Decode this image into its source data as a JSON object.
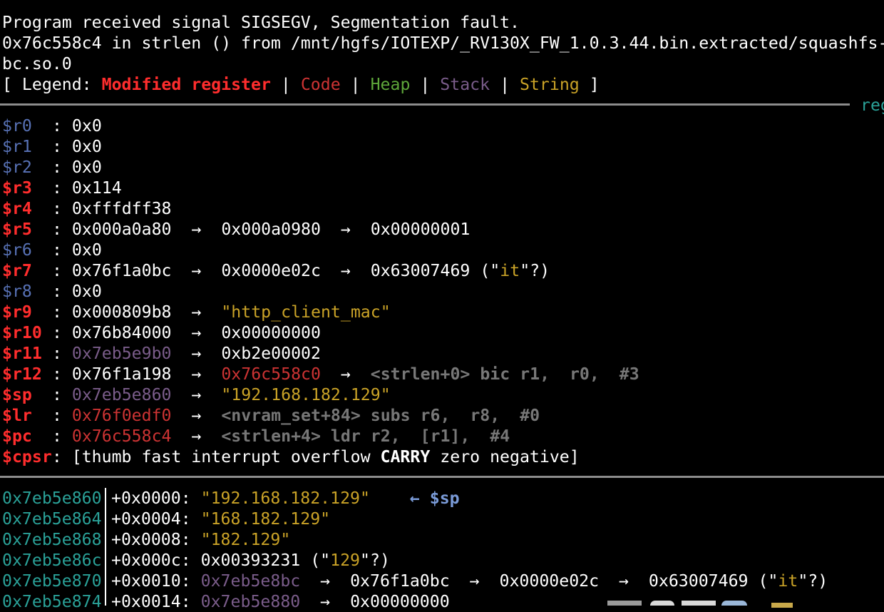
{
  "header": {
    "line1": "Program received signal SIGSEGV, Segmentation fault.",
    "line2": "0x76c558c4 in strlen () from /mnt/hgfs/IOTEXP/_RV130X_FW_1.0.3.44.bin.extracted/squashfs-",
    "line3": "bc.so.0"
  },
  "legend": {
    "open": "[ Legend: ",
    "modified": "Modified register",
    "sep": " | ",
    "code": "Code",
    "heap": "Heap",
    "stack": "Stack",
    "string": "String",
    "close": " ]"
  },
  "registers_label": "reg",
  "registers": {
    "r0": {
      "name": "$r0",
      "value": "0x0"
    },
    "r1": {
      "name": "$r1",
      "value": "0x0"
    },
    "r2": {
      "name": "$r2",
      "value": "0x0"
    },
    "r3": {
      "name": "$r3",
      "value": "0x114"
    },
    "r4": {
      "name": "$r4",
      "value": "0xfffdff38"
    },
    "r5": {
      "name": "$r5",
      "value": "0x000a0a80",
      "p1": "0x000a0980",
      "p2": "0x00000001"
    },
    "r6": {
      "name": "$r6",
      "value": "0x0"
    },
    "r7": {
      "name": "$r7",
      "value": "0x76f1a0bc",
      "p1": "0x0000e02c",
      "p2": "0x63007469",
      "hint_open": " (\"",
      "hint": "it",
      "hint_close": "\"?)"
    },
    "r8": {
      "name": "$r8",
      "value": "0x0"
    },
    "r9": {
      "name": "$r9",
      "value": "0x000809b8",
      "str": "\"http_client_mac\""
    },
    "r10": {
      "name": "$r10",
      "value": "0x76b84000",
      "p1": "0x00000000"
    },
    "r11": {
      "name": "$r11",
      "value": "0x7eb5e9b0",
      "p1": "0xb2e00002"
    },
    "r12": {
      "name": "$r12",
      "value": "0x76f1a198",
      "p1": "0x76c558c0",
      "insn": "<strlen+0> bic r1,  r0,  #3"
    },
    "sp": {
      "name": "$sp",
      "value": "0x7eb5e860",
      "str": "\"192.168.182.129\""
    },
    "lr": {
      "name": "$lr",
      "value": "0x76f0edf0",
      "insn": "<nvram_set+84> subs r6,  r8,  #0"
    },
    "pc": {
      "name": "$pc",
      "value": "0x76c558c4",
      "insn": "<strlen+4> ldr r2,  [r1],  #4"
    },
    "cpsr": {
      "name": "$cpsr",
      "flags_a": "[thumb fast interrupt overflow ",
      "carry": "CARRY",
      "flags_b": " zero negative]"
    }
  },
  "arrow": "→",
  "colon": ": ",
  "stack": [
    {
      "addr": "0x7eb5e860",
      "off": "+0x0000: ",
      "str": "\"192.168.182.129\"",
      "mark_arrow": "←",
      "mark": "$sp"
    },
    {
      "addr": "0x7eb5e864",
      "off": "+0x0004: ",
      "str": "\"168.182.129\""
    },
    {
      "addr": "0x7eb5e868",
      "off": "+0x0008: ",
      "str": "\"182.129\""
    },
    {
      "addr": "0x7eb5e86c",
      "off": "+0x000c: ",
      "val": "0x00393231",
      "hint_open": " (\"",
      "hint": "129",
      "hint_close": "\"?)"
    },
    {
      "addr": "0x7eb5e870",
      "off": "+0x0010: ",
      "val": "0x7eb5e8bc",
      "p1": "0x76f1a0bc",
      "p2": "0x0000e02c",
      "p3": "0x63007469",
      "hint_open": " (\"",
      "hint": "it",
      "hint_close": "\"?)"
    },
    {
      "addr": "0x7eb5e874",
      "off": "+0x0014: ",
      "val": "0x7eb5e880",
      "p1": "0x00000000"
    }
  ],
  "colors": {
    "modified": "#ff2d2d",
    "code": "#cc3333",
    "heap": "#5ea73a",
    "stack": "#7a5c8a",
    "string": "#c9a227",
    "address": "#2aa198",
    "register_unchanged": "#5872b6"
  }
}
